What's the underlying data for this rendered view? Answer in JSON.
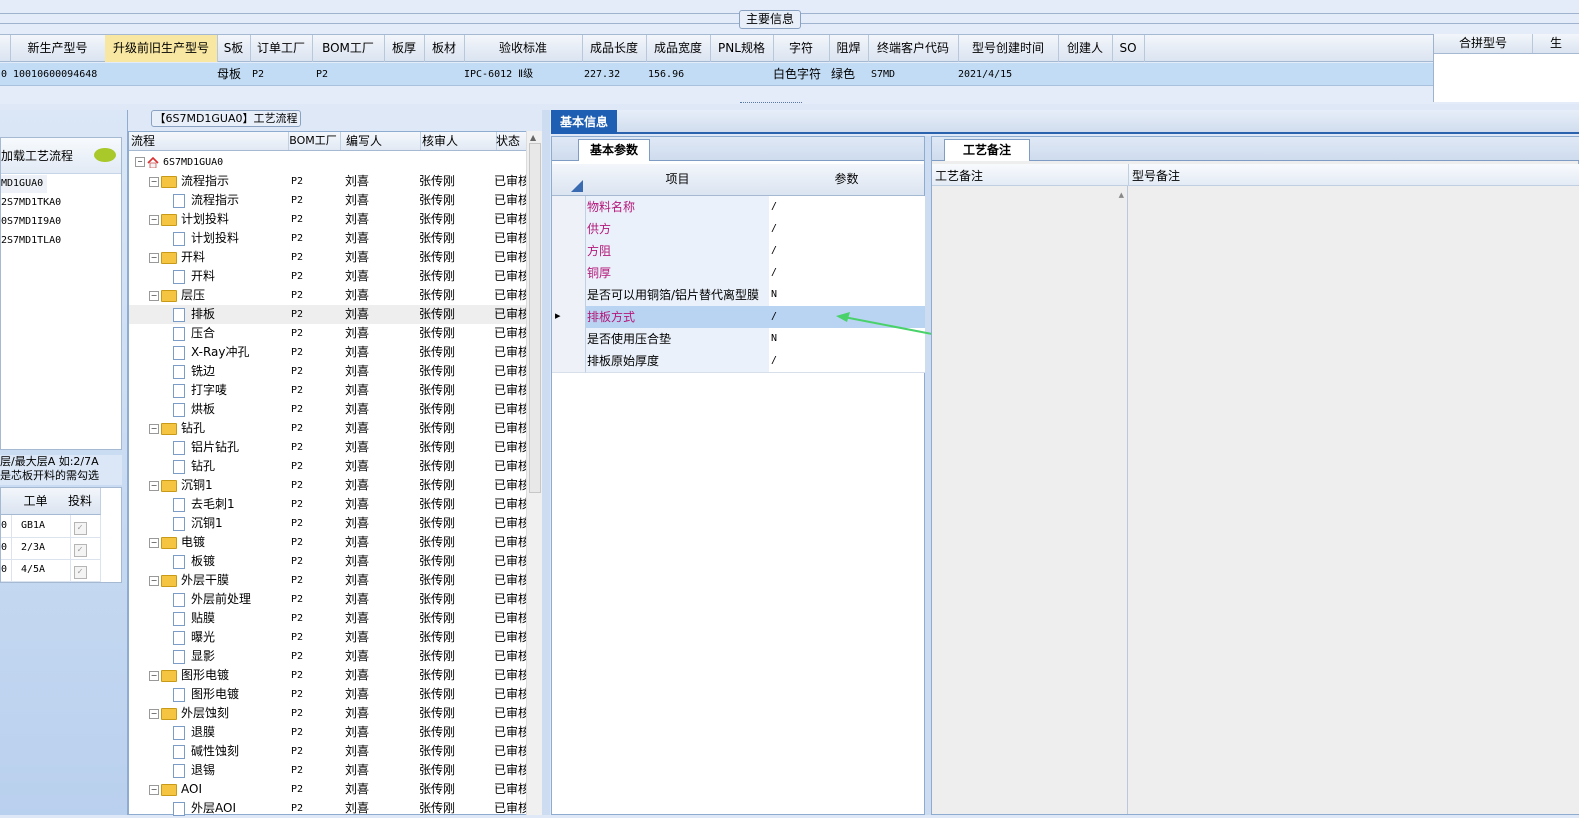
{
  "main_info": {
    "title": "主要信息",
    "columns": [
      "新生产型号",
      "升级前旧生产型号",
      "S板",
      "订单工厂",
      "BOM工厂",
      "板厚",
      "板材",
      "验收标准",
      "成品长度",
      "成品宽度",
      "PNL规格",
      "字符",
      "阻焊",
      "终端客户代码",
      "型号创建时间",
      "创建人",
      "SO"
    ],
    "row": {
      "first_cell": "0",
      "model": "10010600094648",
      "s_board": "母板",
      "order_factory": "P2",
      "bom_factory": "P2",
      "standard": "IPC-6012 Ⅱ级",
      "length": "227.32",
      "width": "156.96",
      "char": "白色字符",
      "mask": "绿色",
      "customer": "S7MD",
      "created": "2021/4/15"
    },
    "right_columns": [
      "合拼型号",
      "生"
    ]
  },
  "left_panel": {
    "load_label": "加载工艺流程",
    "codes": [
      "MD1GUA0",
      "2S7MD1TKA0",
      "0S7MD1I9A0",
      "2S7MD1TLA0"
    ],
    "layer_note_1": "层/最大层A 如:2/7A",
    "layer_note_2": "是芯板开料的需勾选",
    "grid_headers": [
      "工单",
      "投料"
    ],
    "grid_rows": [
      {
        "prefix": "0",
        "order": "GB1A"
      },
      {
        "prefix": "0",
        "order": "2/3A"
      },
      {
        "prefix": "0",
        "order": "4/5A"
      }
    ]
  },
  "flow": {
    "title": "【6S7MD1GUA0】工艺流程",
    "headers": [
      "流程",
      "BOM工厂",
      "编写人",
      "核审人",
      "状态"
    ],
    "root": "6S7MD1GUA0",
    "rows": [
      {
        "name": "流程指示",
        "level": 1,
        "folder": true
      },
      {
        "name": "流程指示",
        "level": 2,
        "folder": false
      },
      {
        "name": "计划投料",
        "level": 1,
        "folder": true
      },
      {
        "name": "计划投料",
        "level": 2,
        "folder": false
      },
      {
        "name": "开料",
        "level": 1,
        "folder": true
      },
      {
        "name": "开料",
        "level": 2,
        "folder": false
      },
      {
        "name": "层压",
        "level": 1,
        "folder": true
      },
      {
        "name": "排板",
        "level": 2,
        "folder": false
      },
      {
        "name": "压合",
        "level": 2,
        "folder": false
      },
      {
        "name": "X-Ray冲孔",
        "level": 2,
        "folder": false
      },
      {
        "name": "铣边",
        "level": 2,
        "folder": false
      },
      {
        "name": "打字唛",
        "level": 2,
        "folder": false
      },
      {
        "name": "烘板",
        "level": 2,
        "folder": false
      },
      {
        "name": "钻孔",
        "level": 1,
        "folder": true
      },
      {
        "name": "铝片钻孔",
        "level": 2,
        "folder": false
      },
      {
        "name": "钻孔",
        "level": 2,
        "folder": false
      },
      {
        "name": "沉铜1",
        "level": 1,
        "folder": true
      },
      {
        "name": "去毛刺1",
        "level": 2,
        "folder": false
      },
      {
        "name": "沉铜1",
        "level": 2,
        "folder": false
      },
      {
        "name": "电镀",
        "level": 1,
        "folder": true
      },
      {
        "name": "板镀",
        "level": 2,
        "folder": false
      },
      {
        "name": "外层干膜",
        "level": 1,
        "folder": true
      },
      {
        "name": "外层前处理",
        "level": 2,
        "folder": false
      },
      {
        "name": "贴膜",
        "level": 2,
        "folder": false
      },
      {
        "name": "曝光",
        "level": 2,
        "folder": false
      },
      {
        "name": "显影",
        "level": 2,
        "folder": false
      },
      {
        "name": "图形电镀",
        "level": 1,
        "folder": true
      },
      {
        "name": "图形电镀",
        "level": 2,
        "folder": false
      },
      {
        "name": "外层蚀刻",
        "level": 1,
        "folder": true
      },
      {
        "name": "退膜",
        "level": 2,
        "folder": false
      },
      {
        "name": "碱性蚀刻",
        "level": 2,
        "folder": false
      },
      {
        "name": "退锡",
        "level": 2,
        "folder": false
      },
      {
        "name": "AOI",
        "level": 1,
        "folder": true
      },
      {
        "name": "外层AOI",
        "level": 2,
        "folder": false
      }
    ],
    "bom": "P2",
    "author": "刘喜",
    "reviewer": "张传刚",
    "status": "已审核"
  },
  "basic": {
    "tab": "基本信息",
    "param_tab": "基本参数",
    "headers": [
      "项目",
      "参数"
    ],
    "rows": [
      {
        "item": "物料名称",
        "value": "/",
        "pink": true
      },
      {
        "item": "供方",
        "value": "/",
        "pink": true
      },
      {
        "item": "方阻",
        "value": "/",
        "pink": true
      },
      {
        "item": "铜厚",
        "value": "/",
        "pink": true
      },
      {
        "item": "是否可以用铜箔/铝片替代离型膜",
        "value": "N",
        "pink": false
      },
      {
        "item": "排板方式",
        "value": "/",
        "pink": true
      },
      {
        "item": "是否使用压合垫",
        "value": "N",
        "pink": false
      },
      {
        "item": "排板原始厚度",
        "value": "/",
        "pink": false
      }
    ]
  },
  "remarks": {
    "tab": "工艺备注",
    "col1": "工艺备注",
    "col2": "型号备注"
  },
  "colors": {
    "selected_tab": "#1f5fb3",
    "selected_row": "#b9d3f2",
    "pink_text": "#b4187a",
    "arrow": "#49d16a"
  }
}
